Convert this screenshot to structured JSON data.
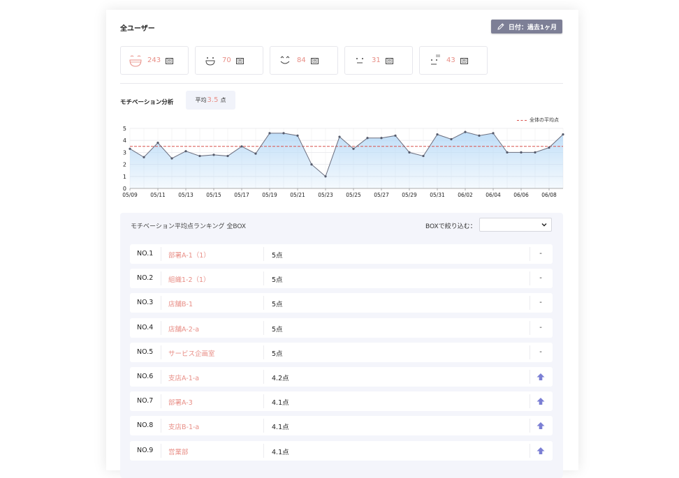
{
  "header": {
    "title": "全ユーザー",
    "date_button": "日付：過去1ヶ月"
  },
  "moods": [
    {
      "icon": "very-happy-face-icon",
      "count": "243",
      "unit": "回"
    },
    {
      "icon": "happy-face-icon",
      "count": "70",
      "unit": "回"
    },
    {
      "icon": "smile-face-icon",
      "count": "84",
      "unit": "回"
    },
    {
      "icon": "neutral-face-icon",
      "count": "31",
      "unit": "回"
    },
    {
      "icon": "sad-face-icon",
      "count": "43",
      "unit": "回"
    }
  ],
  "motivation": {
    "label": "モチベーション分析",
    "avg_prefix": "平均",
    "avg_value": "3.5",
    "avg_suffix": "点",
    "legend": "全体の平均点"
  },
  "chart_data": {
    "type": "line",
    "x": [
      "05/09",
      "05/10",
      "05/11",
      "05/12",
      "05/13",
      "05/14",
      "05/15",
      "05/16",
      "05/17",
      "05/18",
      "05/19",
      "05/20",
      "05/21",
      "05/22",
      "05/23",
      "05/24",
      "05/25",
      "05/26",
      "05/27",
      "05/28",
      "05/29",
      "05/30",
      "05/31",
      "06/01",
      "06/02",
      "06/03",
      "06/04",
      "06/05",
      "06/06",
      "06/07",
      "06/08",
      "06/09"
    ],
    "tick_labels": [
      "05/09",
      "05/11",
      "05/13",
      "05/15",
      "05/17",
      "05/19",
      "05/21",
      "05/23",
      "05/25",
      "05/27",
      "05/29",
      "05/31",
      "06/02",
      "06/04",
      "06/06",
      "06/08"
    ],
    "series": [
      {
        "values": [
          3.3,
          2.6,
          3.8,
          2.5,
          3.1,
          2.7,
          2.8,
          2.7,
          3.5,
          2.9,
          4.6,
          4.6,
          4.4,
          2.0,
          1.0,
          4.3,
          3.3,
          4.2,
          4.2,
          4.4,
          3.0,
          2.7,
          4.5,
          4.1,
          4.7,
          4.4,
          4.6,
          3.0,
          3.0,
          3.0,
          3.4,
          4.5
        ]
      }
    ],
    "reference_line": {
      "label": "全体の平均点",
      "value": 3.5,
      "color": "#d9534f"
    },
    "ylim": [
      0,
      5
    ],
    "yticks": [
      "0",
      "1",
      "2",
      "3",
      "4",
      "5"
    ],
    "grid": true,
    "legend": "top-right",
    "line_color": "#6b6e7e",
    "fill_color": "#bcdcf7"
  },
  "ranking": {
    "title": "モチベーション平均点ランキング 全BOX",
    "filter_label": "BOXで絞り込む：",
    "filter_value": "",
    "rows": [
      {
        "no": "NO.1",
        "name": "部署A-1（1）",
        "score": "5点",
        "trend": "-"
      },
      {
        "no": "NO.2",
        "name": "組織1-2（1）",
        "score": "5点",
        "trend": "-"
      },
      {
        "no": "NO.3",
        "name": "店舗B-1",
        "score": "5点",
        "trend": "-"
      },
      {
        "no": "NO.4",
        "name": "店舗A-2-a",
        "score": "5点",
        "trend": "-"
      },
      {
        "no": "NO.5",
        "name": "サービス企画室",
        "score": "5点",
        "trend": "-"
      },
      {
        "no": "NO.6",
        "name": "支店A-1-a",
        "score": "4.2点",
        "trend": "up"
      },
      {
        "no": "NO.7",
        "name": "部署A-3",
        "score": "4.1点",
        "trend": "up"
      },
      {
        "no": "NO.8",
        "name": "支店B-1-a",
        "score": "4.1点",
        "trend": "up"
      },
      {
        "no": "NO.9",
        "name": "営業部",
        "score": "4.1点",
        "trend": "up"
      }
    ]
  },
  "colors": {
    "accent_pink": "#e88e86",
    "button_gray": "#7d7f96",
    "arrow_up": "#7b7fd4"
  }
}
